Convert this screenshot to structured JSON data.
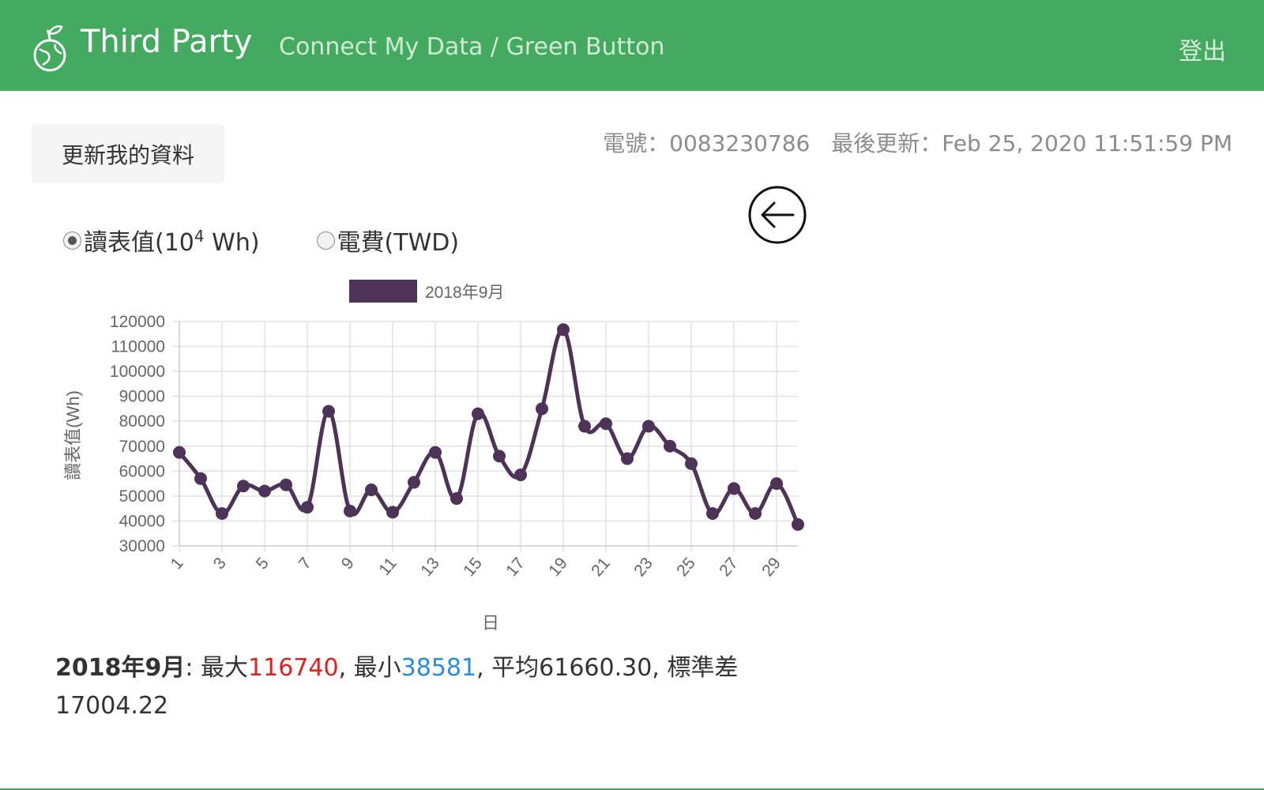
{
  "header": {
    "brand": "Third Party",
    "nav_link": "Connect My Data / Green Button",
    "logout": "登出",
    "logo_icon": "apple-globe-icon"
  },
  "toolbar": {
    "update_label": "更新我的資料"
  },
  "meter": {
    "number_text": "電號：0083230786",
    "updated_text": "最後更新：Feb 25, 2020 11:51:59 PM"
  },
  "back_icon": "arrow-left-circle-icon",
  "radio": {
    "reading_label": "讀表值(10",
    "reading_sup": "4",
    "reading_unit": " Wh)",
    "fee_label": "電費(TWD)",
    "selected": "reading"
  },
  "summary": {
    "label": "2018年9月",
    "max_label": ": 最大",
    "max": "116740",
    "min_label": ", 最小",
    "min": "38581",
    "rest": ", 平均61660.30, 標準差17004.22"
  },
  "colors": {
    "header_bg": "#43aa5f",
    "series": "#4e3358",
    "max": "#e02020",
    "min": "#2b8be0"
  },
  "chart_data": {
    "type": "line",
    "legend": "2018年9月",
    "legend_position": "top",
    "xlabel": "日",
    "ylabel": "讀表值(Wh)",
    "ylim": [
      30000,
      120000
    ],
    "yticks": [
      120000,
      110000,
      100000,
      90000,
      80000,
      70000,
      60000,
      50000,
      40000,
      30000
    ],
    "xtick_labels": [
      "1",
      "3",
      "5",
      "7",
      "9",
      "11",
      "13",
      "15",
      "17",
      "19",
      "21",
      "23",
      "25",
      "27",
      "29"
    ],
    "grid": true,
    "x": [
      1,
      2,
      3,
      4,
      5,
      6,
      7,
      8,
      9,
      10,
      11,
      12,
      13,
      14,
      15,
      16,
      17,
      18,
      19,
      20,
      21,
      22,
      23,
      24,
      25,
      26,
      27,
      28,
      29,
      30
    ],
    "series": [
      {
        "name": "2018年9月",
        "values": [
          67500,
          57000,
          43000,
          54000,
          52000,
          54500,
          45500,
          84000,
          44000,
          52500,
          43500,
          55500,
          67500,
          49000,
          83000,
          66000,
          58500,
          85000,
          116740,
          78000,
          79000,
          65000,
          78000,
          70000,
          63000,
          43000,
          53000,
          43000,
          55000,
          38581
        ]
      }
    ]
  }
}
